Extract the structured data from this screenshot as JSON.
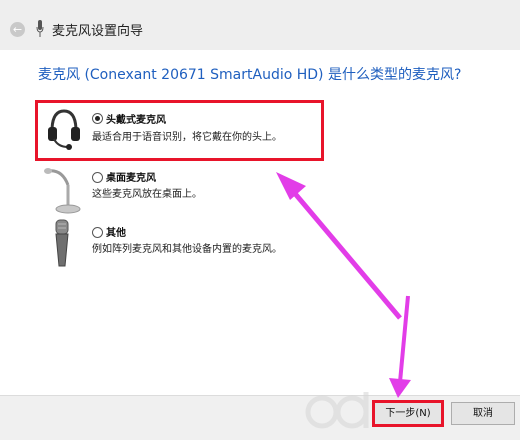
{
  "window": {
    "title": "麦克风设置向导"
  },
  "heading": "麦克风 (Conexant 20671 SmartAudio HD) 是什么类型的麦克风?",
  "options": [
    {
      "label": "头戴式麦克风",
      "description": "最适合用于语音识别，将它戴在你的头上。",
      "selected": true,
      "icon": "headset-icon"
    },
    {
      "label": "桌面麦克风",
      "description": "这些麦克风放在桌面上。",
      "selected": false,
      "icon": "desktop-microphone-icon"
    },
    {
      "label": "其他",
      "description": "例如阵列麦克风和其他设备内置的麦克风。",
      "selected": false,
      "icon": "handheld-microphone-icon"
    }
  ],
  "buttons": {
    "next": "下一步(N)",
    "cancel": "取消"
  },
  "colors": {
    "highlight": "#e8142a",
    "arrow": "#e23de8",
    "heading": "#1f5fbf"
  }
}
